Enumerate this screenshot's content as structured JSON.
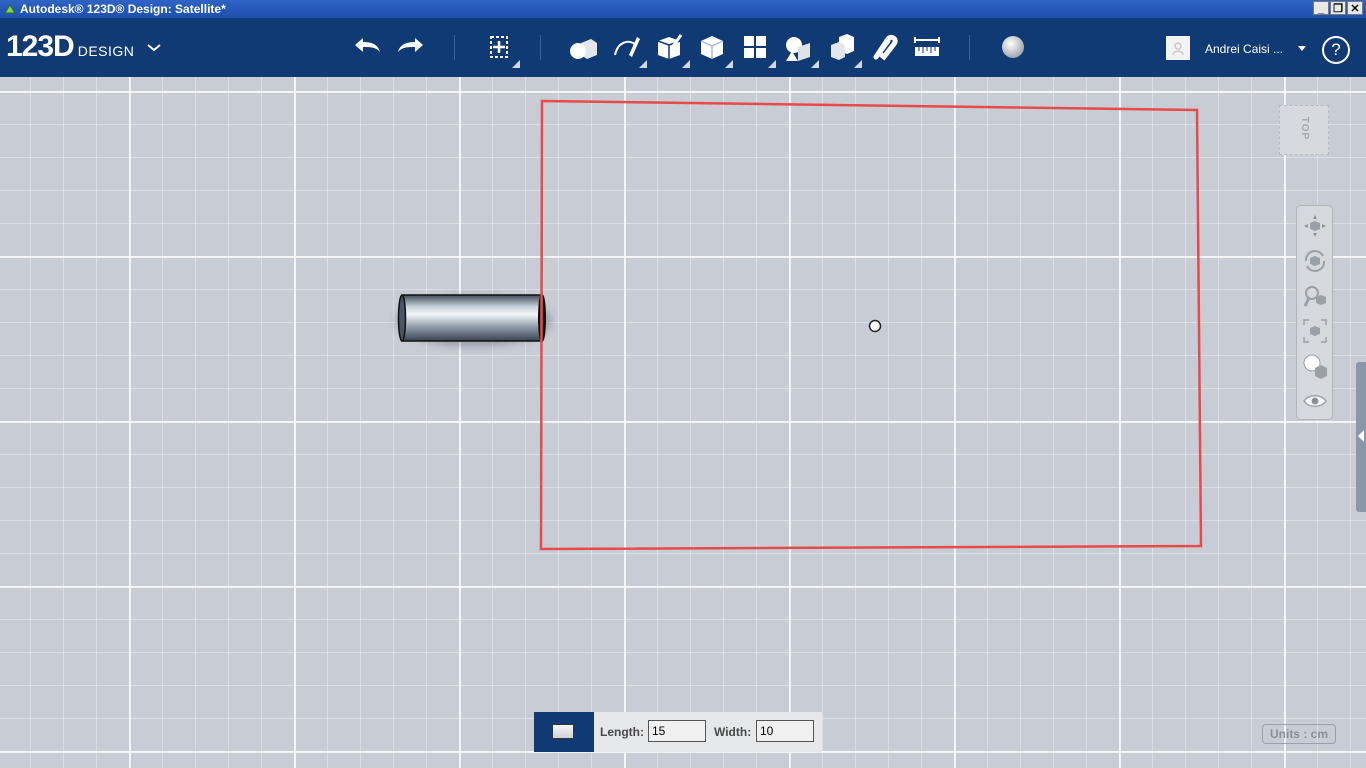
{
  "window": {
    "title": "Autodesk® 123D® Design: Satellite*",
    "minimize": "_",
    "restore": "❐",
    "close": "✕"
  },
  "brand": {
    "name": "123D",
    "product": "DESIGN"
  },
  "toolbar": {
    "tools": [
      "undo-icon",
      "redo-icon",
      "transform-icon",
      "primitives-icon",
      "sketch-icon",
      "construct-icon",
      "modify-icon",
      "pattern-icon",
      "grouping-icon",
      "combine-icon",
      "snap-icon",
      "measure-icon",
      "material-icon"
    ]
  },
  "user": {
    "name": "Andrei Caisi ..."
  },
  "help": {
    "label": "?"
  },
  "viewcube": {
    "label": "TOP"
  },
  "navigation": {
    "tools": [
      "pan-icon",
      "orbit-icon",
      "zoom-icon",
      "fit-icon",
      "visual-style-icon",
      "view-icon"
    ]
  },
  "units": {
    "label": "Units : cm"
  },
  "dimensions": {
    "length_label": "Length:",
    "length_value": "15",
    "width_label": "Width:",
    "width_value": "10"
  },
  "colors": {
    "toolbar": "#103a73",
    "sketch_line": "#e84a4a"
  }
}
